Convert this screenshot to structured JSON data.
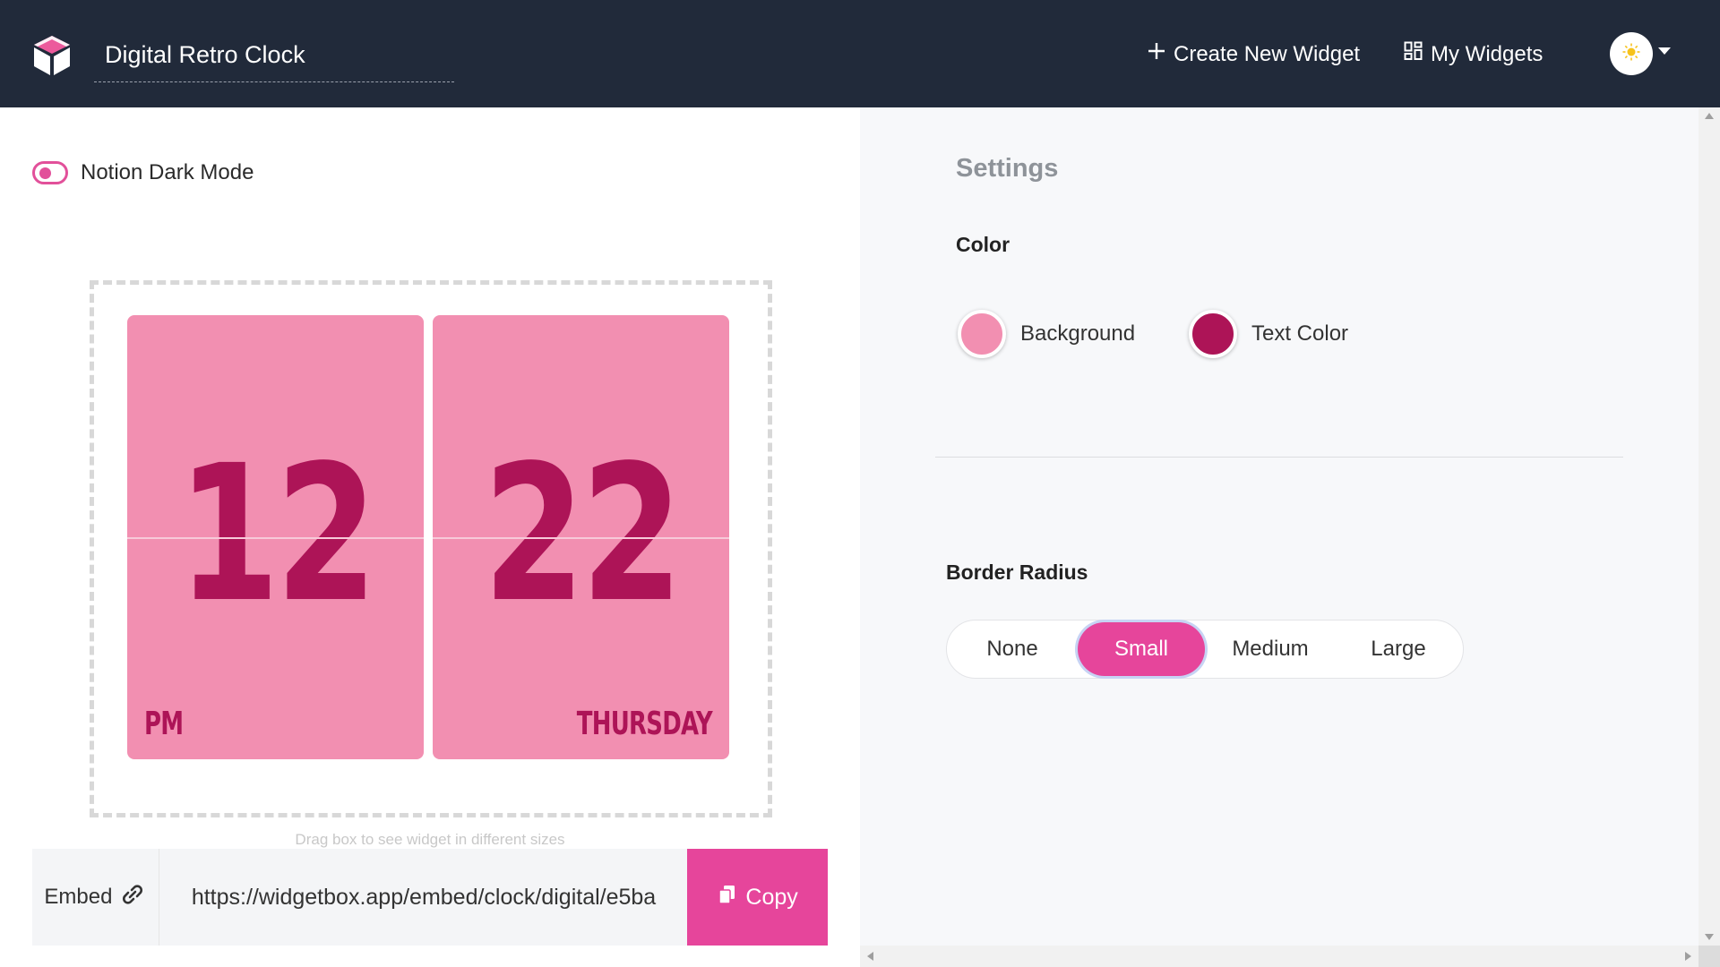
{
  "header": {
    "title": "Digital Retro Clock",
    "create_label": "Create New Widget",
    "widgets_label": "My Widgets",
    "logo_icon": "cube-logo-icon",
    "avatar_icon": "sun-icon"
  },
  "preview": {
    "dark_mode_label": "Notion Dark Mode",
    "dark_mode_on": true,
    "hour": "12",
    "minute": "22",
    "period": "PM",
    "day": "THURSDAY",
    "drag_hint": "Drag box to see widget in different sizes"
  },
  "embed": {
    "label": "Embed",
    "url": "https://widgetbox.app/embed/clock/digital/e5ba",
    "copy_label": "Copy"
  },
  "settings": {
    "title": "Settings",
    "color_heading": "Color",
    "background_label": "Background",
    "background_color": "#f28fb1",
    "text_color_label": "Text Color",
    "text_color": "#ad1457",
    "radius_heading": "Border Radius",
    "radius_options": [
      "None",
      "Small",
      "Medium",
      "Large"
    ],
    "radius_selected": "Small"
  },
  "colors": {
    "header_bg": "#212a3a",
    "accent": "#e6459b"
  }
}
